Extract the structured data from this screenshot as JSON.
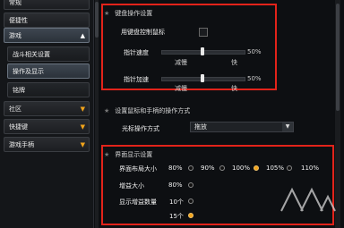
{
  "sidebar": {
    "items": [
      {
        "label": "常规"
      },
      {
        "label": "便捷性"
      },
      {
        "label": "游戏"
      },
      {
        "label": "战斗相关设置"
      },
      {
        "label": "操作及显示"
      },
      {
        "label": "铭牌"
      },
      {
        "label": "社区"
      },
      {
        "label": "快捷键"
      },
      {
        "label": "游戏手柄"
      }
    ]
  },
  "keyboard_section": {
    "title": "键盘操作设置",
    "checkbox_label": "用键盘控制鼠标",
    "pointer_speed": {
      "label": "指针速度",
      "value": "50%",
      "min_label": "减慢",
      "max_label": "快",
      "level": 0.5
    },
    "pointer_accel": {
      "label": "指针加速",
      "value": "50%",
      "min_label": "减慢",
      "max_label": "快",
      "level": 0.5
    }
  },
  "mouse_section": {
    "title": "设置鼠标和手柄的操作方式",
    "cursor_label": "光标操作方式",
    "cursor_value": "拖放"
  },
  "display_section": {
    "title": "界面显示设置",
    "ui_scale": {
      "label": "界面布局大小",
      "options": [
        "80%",
        "90%",
        "100%",
        "105%",
        "110%"
      ],
      "selected": 3
    },
    "gain_size": {
      "label": "增益大小",
      "options": [
        "80%"
      ]
    },
    "gain_count": {
      "label": "显示增益数量",
      "options": [
        "10个",
        "15个"
      ]
    }
  },
  "colors": {
    "accent": "#f2a41b",
    "highlight": "#e2231a"
  }
}
